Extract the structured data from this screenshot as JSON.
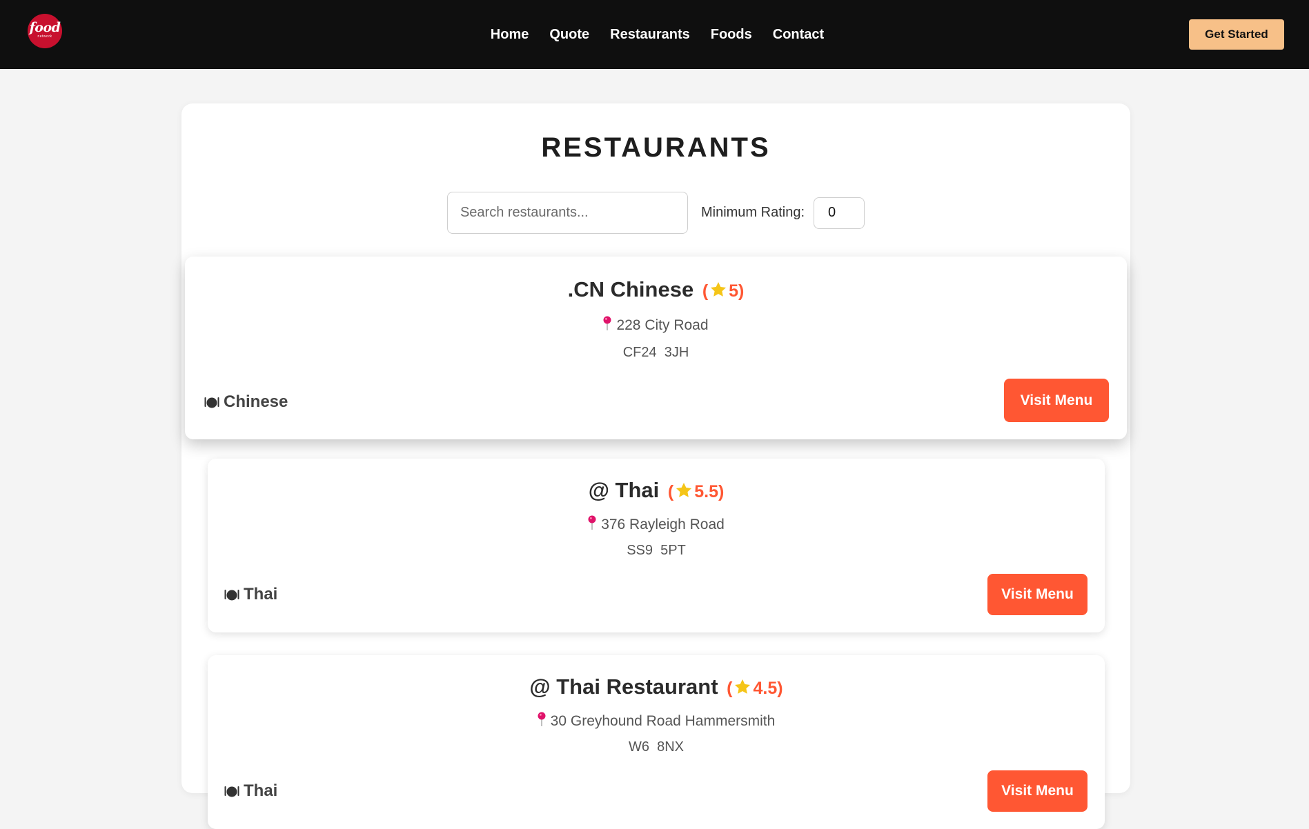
{
  "header": {
    "logo": {
      "word": "food",
      "sub": "network"
    },
    "nav": [
      "Home",
      "Quote",
      "Restaurants",
      "Foods",
      "Contact"
    ],
    "cta_label": "Get Started"
  },
  "page": {
    "title": "RESTAURANTS",
    "search_placeholder": "Search restaurants...",
    "min_rating_label": "Minimum Rating:",
    "min_rating_value": "0"
  },
  "icons": {
    "rating": "star-icon",
    "address": "pin-icon",
    "cuisine": "plate-icon"
  },
  "colors": {
    "accent": "#ff5733",
    "star": "#f5c518",
    "pin": "#e0136a",
    "cta": "#f7c088",
    "header_bg": "#0f0f0f"
  },
  "restaurants": [
    {
      "name": ".CN Chinese",
      "rating_open": "(",
      "rating": "5)",
      "address": "228 City Road",
      "postcode": "CF24  3JH",
      "cuisine": "Chinese",
      "button": "Visit Menu"
    },
    {
      "name": "@ Thai",
      "rating_open": "(",
      "rating": "5.5)",
      "address": "376 Rayleigh Road",
      "postcode": "SS9  5PT",
      "cuisine": "Thai",
      "button": "Visit Menu"
    },
    {
      "name": "@ Thai Restaurant",
      "rating_open": "(",
      "rating": "4.5)",
      "address": "30 Greyhound Road Hammersmith",
      "postcode": "W6  8NX",
      "cuisine": "Thai",
      "button": "Visit Menu"
    }
  ]
}
